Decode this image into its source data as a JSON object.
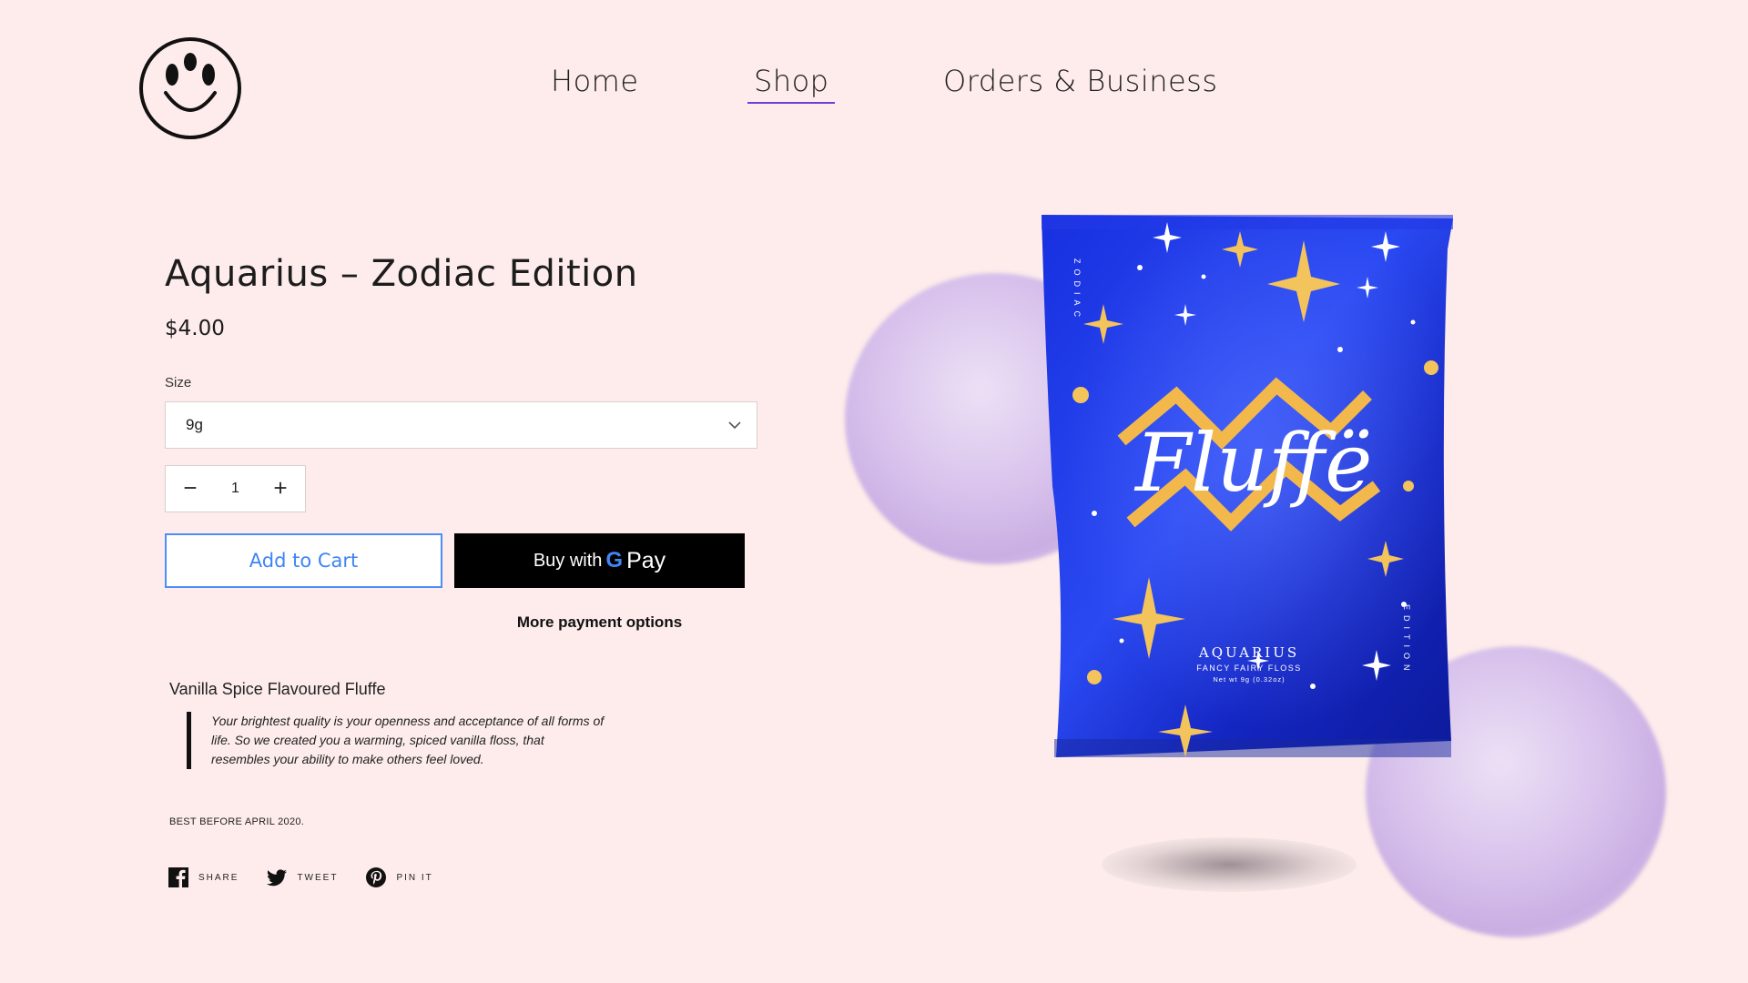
{
  "nav": {
    "home": "Home",
    "shop": "Shop",
    "orders": "Orders & Business"
  },
  "product": {
    "title": "Aquarius – Zodiac Edition",
    "price": "$4.00",
    "size_label": "Size",
    "size_value": "9g",
    "quantity": "1",
    "add_to_cart": "Add to Cart",
    "gpay_prefix": "Buy with",
    "gpay_g": "G",
    "gpay_pay": "Pay",
    "more_payment": "More payment options",
    "description_title": "Vanilla Spice Flavoured Fluffe",
    "description_quote": "Your brightest quality is your openness and acceptance of all forms of life. So we created you a warming, spiced vanilla floss, that resembles your ability to make others feel loved.",
    "best_before": "BEST BEFORE APRIL 2020."
  },
  "share": {
    "facebook": "SHARE",
    "twitter": "TWEET",
    "pinterest": "PIN IT"
  },
  "bag": {
    "brand": "Fluffë",
    "side_left": "ZODIAC",
    "side_right": "EDITION",
    "name": "AQUARIUS",
    "subtitle": "FANCY FAIRY FLOSS",
    "weight": "Net wt 9g (0.32oz)"
  },
  "colors": {
    "background": "#fdeceb",
    "accent_underline": "#6c3fd8",
    "cart_blue": "#3d84f7",
    "bag_blue": "#1a2fd6",
    "gold": "#f2b84b"
  }
}
